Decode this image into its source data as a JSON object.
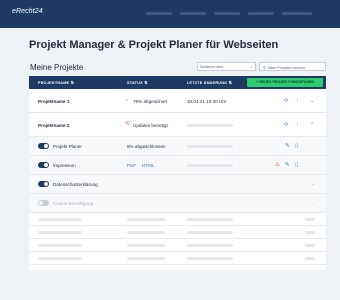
{
  "app": {
    "logo_text": "eRecht24"
  },
  "page": {
    "title": "Projekt Manager & Projekt Planer für Webseiten",
    "section_title": "Meine Projekte"
  },
  "controls": {
    "sort_label": "Sortieren nach",
    "search_placeholder": "Nach Projekten suchen..."
  },
  "table": {
    "headers": {
      "name": "PROJEKTNAME",
      "status": "STATUS",
      "changed": "LETZTE ÄNDERUNG"
    },
    "new_project_button": "+ NEUES PROJEKT HINZUFÜGEN",
    "projects": [
      {
        "name": "Projektname 1",
        "status": "75% abgesichert",
        "date": "10.04.21 10:30 Uhr"
      },
      {
        "name": "Projektname 2",
        "status": "Updates benötigt"
      }
    ],
    "subitems": [
      {
        "label": "Projekt Planer",
        "status": "5% abgeschlossen",
        "enabled": true
      },
      {
        "label": "Impressum",
        "link1": "PDF",
        "link2": "HTML",
        "enabled": true
      },
      {
        "label": "Datenschutzerklärung",
        "enabled": true
      },
      {
        "label": "Cookie-Einwilligung",
        "enabled": false
      }
    ]
  },
  "colors": {
    "header_bg": "#1f3b63",
    "accent_green": "#2ecc71",
    "accent_blue": "#3b78c4",
    "status_orange": "#f39c12"
  }
}
